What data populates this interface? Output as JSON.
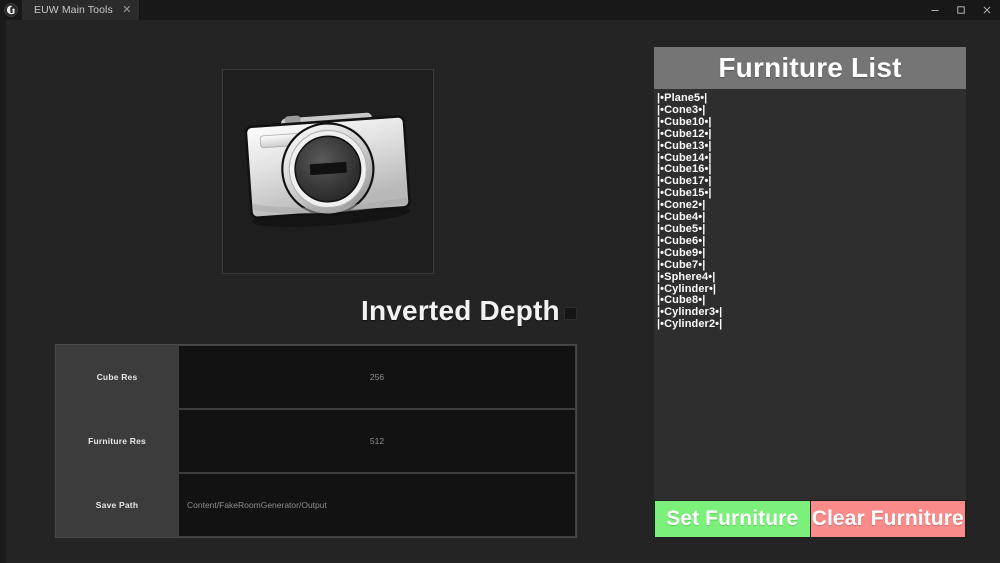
{
  "window": {
    "logo_icon": "unreal-engine-logo",
    "tab": {
      "label": "EUW Main Tools",
      "close_icon": "close-icon"
    },
    "controls": {
      "minimize_icon": "minimize-icon",
      "maximize_icon": "maximize-icon",
      "close_icon": "close-icon"
    }
  },
  "preview": {
    "alt": "camera-thumbnail",
    "icon": "camera-3d-render"
  },
  "depth": {
    "title": "Inverted Depth",
    "checkbox_name": "inverted-depth-checkbox",
    "checked": false
  },
  "settings": {
    "rows": [
      {
        "label": "Cube Res",
        "value": "256",
        "align": "center",
        "placeholder": "256"
      },
      {
        "label": "Furniture Res",
        "value": "512",
        "align": "center",
        "placeholder": "512"
      },
      {
        "label": "Save Path",
        "value": "Content/FakeRoomGenerator/Output",
        "align": "left",
        "placeholder": "Content/FakeRoomGenerator/Output"
      }
    ]
  },
  "furniture": {
    "header": "Furniture List",
    "items": [
      "|•Plane5•|",
      "|•Cone3•|",
      "|•Cube10•|",
      "|•Cube12•|",
      "|•Cube13•|",
      "|•Cube14•|",
      "|•Cube16•|",
      "|•Cube17•|",
      "|•Cube15•|",
      "|•Cone2•|",
      "|•Cube4•|",
      "|•Cube5•|",
      "|•Cube6•|",
      "|•Cube9•|",
      "|•Cube7•|",
      "|•Sphere4•|",
      "|•Cylinder•|",
      "|•Cube8•|",
      "|•Cylinder3•|",
      "|•Cylinder2•|"
    ],
    "set_button": "Set Furniture",
    "clear_button": "Clear Furniture"
  },
  "colors": {
    "set_button_bg": "#7bf07b",
    "clear_button_bg": "#f98b8b",
    "header_bg": "#757575",
    "list_bg": "#2e2e2e",
    "panel_bg": "#3c3c3c",
    "field_bg": "#121212",
    "workspace_bg": "#242424",
    "titlebar_bg": "#181818"
  }
}
